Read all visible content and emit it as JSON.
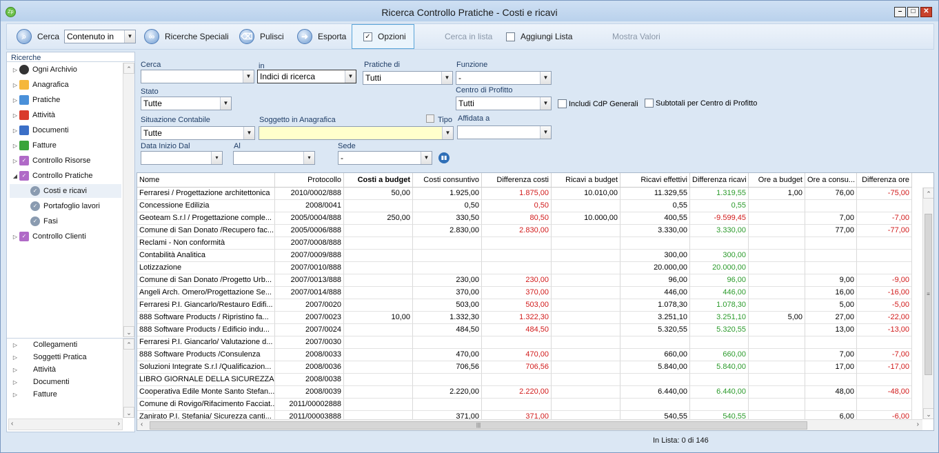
{
  "window": {
    "title": "Ricerca Controllo Pratiche - Costi e ricavi",
    "app_icon": "Zp"
  },
  "toolbar": {
    "cerca_label": "Cerca",
    "cerca_mode": "Contenuto in",
    "ricerche_speciali": "Ricerche Speciali",
    "pulisci": "Pulisci",
    "esporta": "Esporta",
    "opzioni": "Opzioni",
    "cerca_in_lista": "Cerca in lista",
    "aggiungi_lista": "Aggiungi Lista",
    "mostra_valori": "Mostra Valori"
  },
  "sidebar": {
    "header": "Ricerche",
    "items": [
      {
        "label": "Ogni Archivio",
        "icon": "database-icon",
        "color": "#333333"
      },
      {
        "label": "Anagrafica",
        "icon": "anagrafica-icon",
        "color": "#f5b73b"
      },
      {
        "label": "Pratiche",
        "icon": "pratiche-icon",
        "color": "#4a90d9"
      },
      {
        "label": "Attività",
        "icon": "attivita-icon",
        "color": "#d93a2b"
      },
      {
        "label": "Documenti",
        "icon": "documenti-icon",
        "color": "#3b6fc7"
      },
      {
        "label": "Fatture",
        "icon": "fatture-icon",
        "color": "#39a43a"
      },
      {
        "label": "Controllo Risorse",
        "icon": "controllo-icon",
        "color": "#b06ac7"
      },
      {
        "label": "Controllo Pratiche",
        "icon": "controllo-icon",
        "color": "#b06ac7"
      },
      {
        "label": "Costi e ricavi",
        "icon": "check-circle-icon",
        "color": "#8a9bb0"
      },
      {
        "label": "Portafoglio lavori",
        "icon": "check-circle-icon",
        "color": "#8a9bb0"
      },
      {
        "label": "Fasi",
        "icon": "check-circle-icon",
        "color": "#8a9bb0"
      },
      {
        "label": "Controllo Clienti",
        "icon": "controllo-icon",
        "color": "#b06ac7"
      }
    ],
    "bottom_items": [
      "Collegamenti",
      "Soggetti Pratica",
      "Attività",
      "Documenti",
      "Fatture"
    ]
  },
  "form": {
    "cerca_label": "Cerca",
    "in_label": "in",
    "in_value": "Indici di ricerca",
    "pratiche_di_label": "Pratiche di",
    "pratiche_di_value": "Tutti",
    "funzione_label": "Funzione",
    "funzione_value": "-",
    "stato_label": "Stato",
    "stato_value": "Tutte",
    "centro_label": "Centro di Profitto",
    "centro_value": "Tutti",
    "includi_cdp": "Includi CdP Generali",
    "subtotali": "Subtotali per Centro di Profitto",
    "situazione_label": "Situazione Contabile",
    "situazione_value": "Tutte",
    "soggetto_label": "Soggetto in Anagrafica",
    "tipo_label": "Tipo",
    "affidata_label": "Affidata a",
    "data_label": "Data Inizio Dal",
    "al_label": "Al",
    "sede_label": "Sede",
    "sede_value": "-"
  },
  "table": {
    "columns": [
      "Nome",
      "Protocollo",
      "Costi a budget",
      "Costi consuntivo",
      "Differenza costi",
      "Ricavi a budget",
      "Ricavi effettivi",
      "Differenza ricavi",
      "Ore a budget",
      "Ore a consu...",
      "Differenza ore"
    ],
    "rows": [
      [
        "Ferraresi / Progettazione architettonica",
        "2010/0002/888",
        "50,00",
        "1.925,00",
        "1.875,00",
        "10.010,00",
        "11.329,55",
        "1.319,55",
        "1,00",
        "76,00",
        "-75,00"
      ],
      [
        "Concessione Edilizia",
        "2008/0041",
        "",
        "0,50",
        "0,50",
        "",
        "0,55",
        "0,55",
        "",
        "",
        ""
      ],
      [
        "Geoteam S.r.l  / Progettazione comple...",
        "2005/0004/888",
        "250,00",
        "330,50",
        "80,50",
        "10.000,00",
        "400,55",
        "-9.599,45",
        "",
        "7,00",
        "-7,00"
      ],
      [
        "Comune di San Donato  /Recupero fac...",
        "2005/0006/888",
        "",
        "2.830,00",
        "2.830,00",
        "",
        "3.330,00",
        "3.330,00",
        "",
        "77,00",
        "-77,00"
      ],
      [
        "Reclami - Non conformità",
        "2007/0008/888",
        "",
        "",
        "",
        "",
        "",
        "",
        "",
        "",
        ""
      ],
      [
        "Contabilità Analitica",
        "2007/0009/888",
        "",
        "",
        "",
        "",
        "300,00",
        "300,00",
        "",
        "",
        ""
      ],
      [
        "Lotizzazione",
        "2007/0010/888",
        "",
        "",
        "",
        "",
        "20.000,00",
        "20.000,00",
        "",
        "",
        ""
      ],
      [
        "Comune di San Donato  /Progetto Urb...",
        "2007/0013/888",
        "",
        "230,00",
        "230,00",
        "",
        "96,00",
        "96,00",
        "",
        "9,00",
        "-9,00"
      ],
      [
        "Angeli Arch. Omero/Progettazione Se...",
        "2007/0014/888",
        "",
        "370,00",
        "370,00",
        "",
        "446,00",
        "446,00",
        "",
        "16,00",
        "-16,00"
      ],
      [
        "Ferraresi P.I. Giancarlo/Restauro Edifi...",
        "2007/0020",
        "",
        "503,00",
        "503,00",
        "",
        "1.078,30",
        "1.078,30",
        "",
        "5,00",
        "-5,00"
      ],
      [
        "888 Software Products  / Ripristino fa...",
        "2007/0023",
        "10,00",
        "1.332,30",
        "1.322,30",
        "",
        "3.251,10",
        "3.251,10",
        "5,00",
        "27,00",
        "-22,00"
      ],
      [
        "888 Software Products  / Edificio indu...",
        "2007/0024",
        "",
        "484,50",
        "484,50",
        "",
        "5.320,55",
        "5.320,55",
        "",
        "13,00",
        "-13,00"
      ],
      [
        "Ferraresi P.I. Giancarlo/ Valutazione d...",
        "2007/0030",
        "",
        "",
        "",
        "",
        "",
        "",
        "",
        "",
        ""
      ],
      [
        "888 Software Products  /Consulenza",
        "2008/0033",
        "",
        "470,00",
        "470,00",
        "",
        "660,00",
        "660,00",
        "",
        "7,00",
        "-7,00"
      ],
      [
        "Soluzioni Integrate S.r.l  /Qualificazion...",
        "2008/0036",
        "",
        "706,56",
        "706,56",
        "",
        "5.840,00",
        "5.840,00",
        "",
        "17,00",
        "-17,00"
      ],
      [
        "LIBRO GIORNALE DELLA SICUREZZA",
        "2008/0038",
        "",
        "",
        "",
        "",
        "",
        "",
        "",
        "",
        ""
      ],
      [
        "Cooperativa Edile Monte Santo Stefan...",
        "2008/0039",
        "",
        "2.220,00",
        "2.220,00",
        "",
        "6.440,00",
        "6.440,00",
        "",
        "48,00",
        "-48,00"
      ],
      [
        "Comune di Rovigo/Rifacimento Facciat...",
        "2011/00002888",
        "",
        "",
        "",
        "",
        "",
        "",
        "",
        "",
        ""
      ],
      [
        "Zanirato P.I. Stefania/ Sicurezza canti...",
        "2011/00003888",
        "",
        "371,00",
        "371,00",
        "",
        "540,55",
        "540,55",
        "",
        "6,00",
        "-6,00"
      ]
    ]
  },
  "status": {
    "in_lista": "In Lista: 0 di 146"
  },
  "colors": {
    "negative": "#d11a1a",
    "positive": "#2a9a2a",
    "highlight_input": "#ffffcc"
  }
}
